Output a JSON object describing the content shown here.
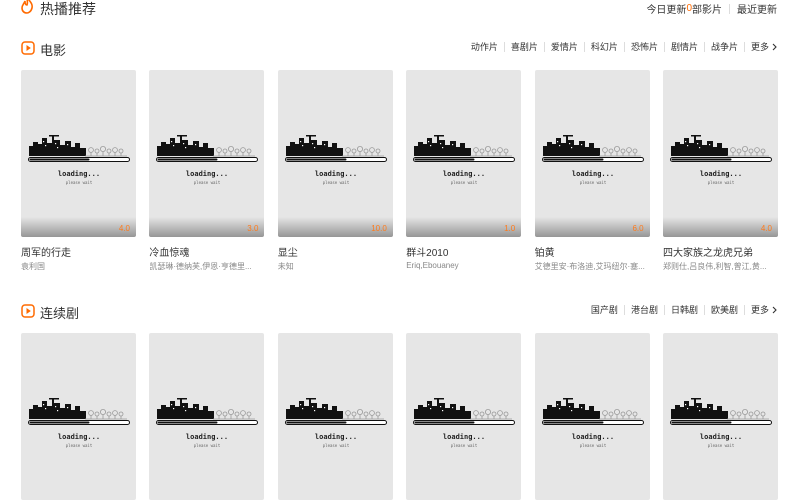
{
  "header": {
    "title": "热播推荐",
    "update_prefix": "今日更新",
    "update_count": "0",
    "update_suffix": "部影片",
    "latest_label": "最近更新",
    "flame_icon": "flame-icon"
  },
  "movie_section": {
    "title": "电影",
    "categories": [
      "动作片",
      "喜剧片",
      "爱情片",
      "科幻片",
      "恐怖片",
      "剧情片",
      "战争片"
    ],
    "more_label": "更多",
    "loading_text": "loading...",
    "loading_sub": "please wait",
    "items": [
      {
        "name": "周军的行走",
        "actors": "袁利国",
        "score": "4.0"
      },
      {
        "name": "冷血惊魂",
        "actors": "凯瑟琳·德纳芙,伊恩·亨德里...",
        "score": "3.0"
      },
      {
        "name": "显尘",
        "actors": "未知",
        "score": "10.0"
      },
      {
        "name": "群斗2010",
        "actors": "Eriq,Ebouaney",
        "score": "1.0"
      },
      {
        "name": "铂黄",
        "actors": "艾德里安·布洛迪,艾玛纽尔·塞...",
        "score": "6.0"
      },
      {
        "name": "四大家族之龙虎兄弟",
        "actors": "郑则仕,吕良伟,利智,曾江,黄...",
        "score": "4.0"
      }
    ]
  },
  "tv_section": {
    "title": "连续剧",
    "categories": [
      "国产剧",
      "港台剧",
      "日韩剧",
      "欧美剧"
    ],
    "more_label": "更多",
    "loading_text": "loading...",
    "loading_sub": "please wait",
    "item_count": 6
  },
  "colors": {
    "accent": "#ff6a00",
    "score": "#ff7a1a",
    "poster_bg": "#e6e6e6"
  }
}
